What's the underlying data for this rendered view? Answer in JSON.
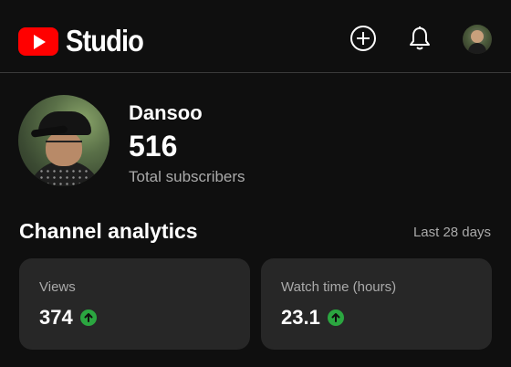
{
  "header": {
    "logo_text": "Studio",
    "icons": [
      "create-icon",
      "notifications-icon",
      "account-avatar"
    ]
  },
  "channel": {
    "name": "Dansoo",
    "subscriber_count": "516",
    "subscriber_label": "Total subscribers"
  },
  "analytics": {
    "title": "Channel analytics",
    "range": "Last 28 days",
    "cards": [
      {
        "label": "Views",
        "value": "374",
        "trend": "up"
      },
      {
        "label": "Watch time (hours)",
        "value": "23.1",
        "trend": "up"
      }
    ]
  },
  "colors": {
    "background": "#0f0f0f",
    "card": "#272727",
    "brand_red": "#ff0000",
    "trend_up": "#2ba640",
    "muted_text": "#aaaaaa"
  }
}
